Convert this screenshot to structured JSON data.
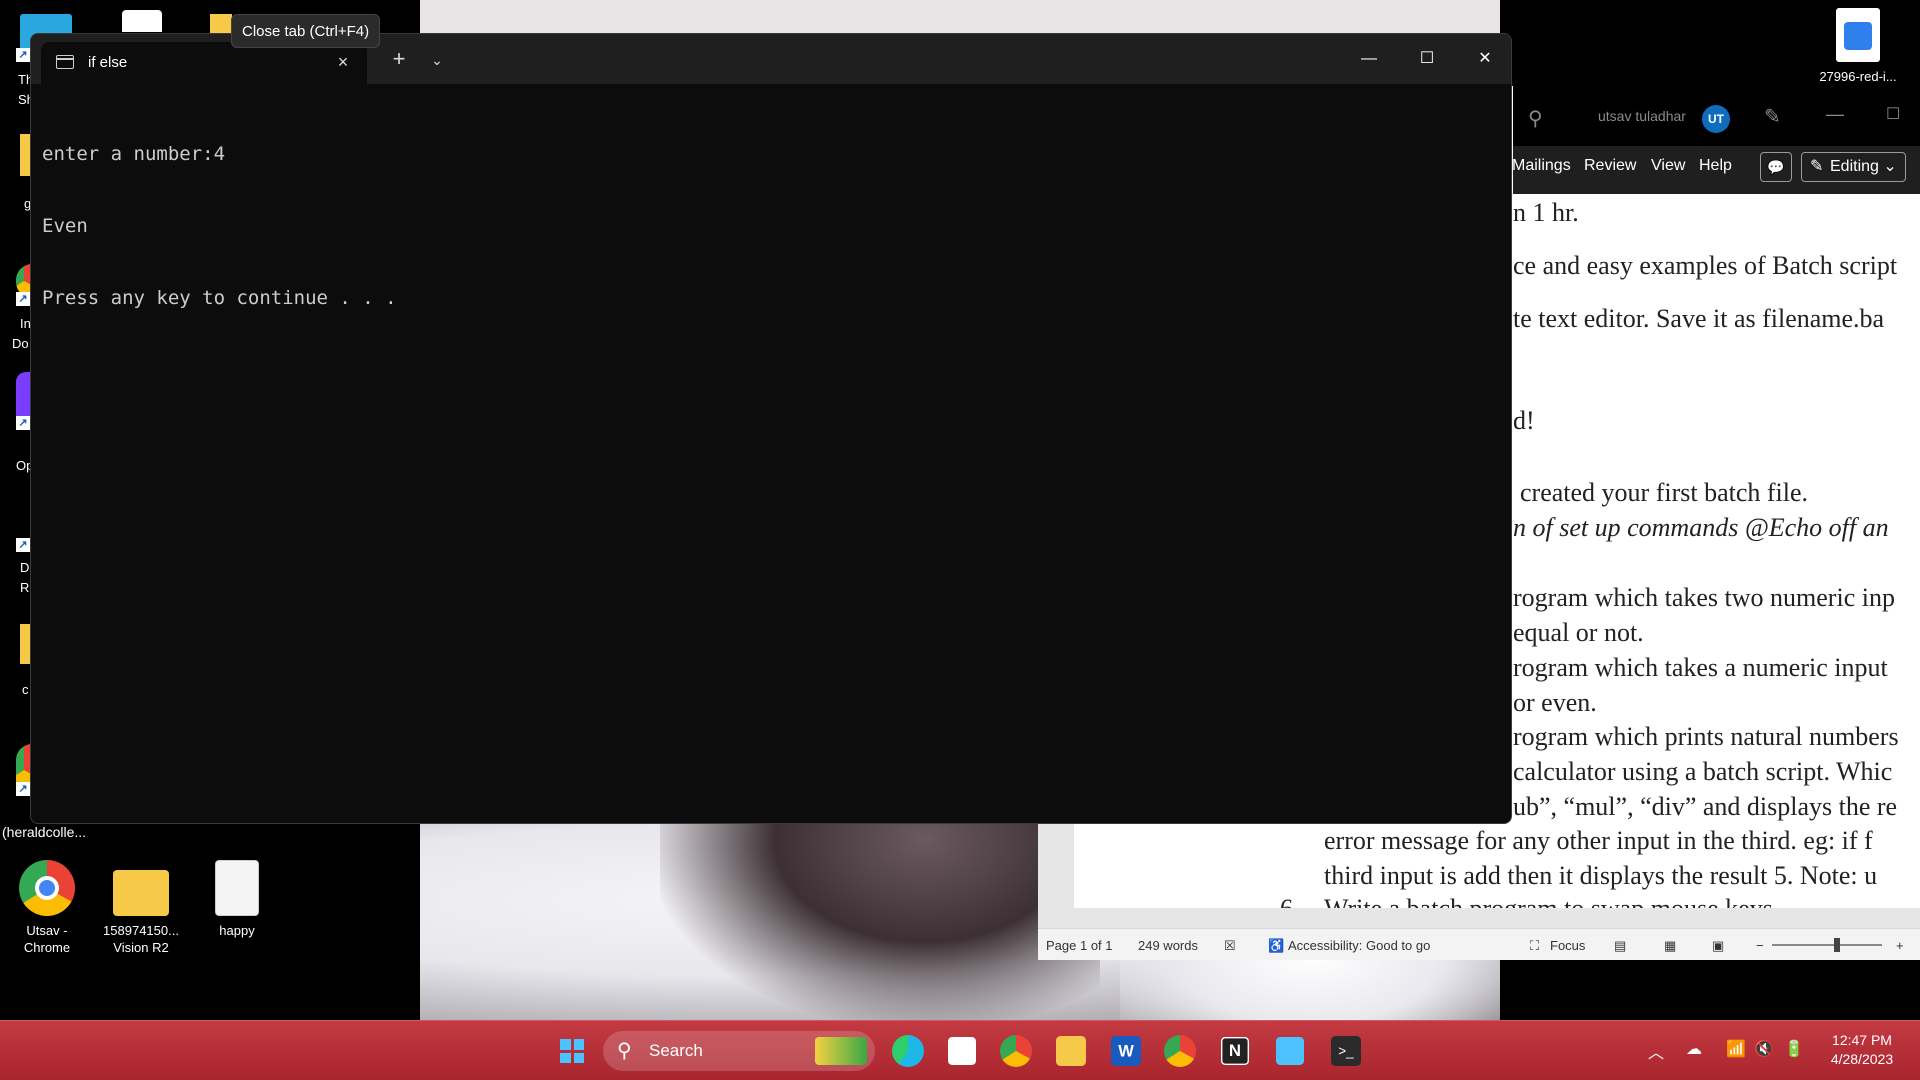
{
  "tooltip": "Close tab (Ctrl+F4)",
  "terminal": {
    "tab_title": "if else",
    "new_tab": "+",
    "dropdown": "⌄",
    "close_tab": "×",
    "minimize": "—",
    "maximize": "☐",
    "close": "✕",
    "lines": [
      "enter a number:4",
      "Even",
      "Press any key to continue . . ."
    ]
  },
  "desktop": {
    "left_labels": [
      "Th",
      "Sh",
      "g",
      "In",
      "Do",
      "Op",
      "D",
      "R",
      "c",
      "(heraldcolle..."
    ],
    "icons": [
      {
        "label": "Utsav -\nChrome",
        "icon": "chrome-icon"
      },
      {
        "label": "158974150...\nVision R2",
        "icon": "folder-icon"
      },
      {
        "label": "happy",
        "icon": "document-icon"
      }
    ],
    "top_right_icon_label": "27996-red-i..."
  },
  "word": {
    "user_name": "utsav tuladhar",
    "avatar_initials": "UT",
    "ribbon_tabs": [
      "Mailings",
      "Review",
      "View",
      "Help"
    ],
    "editing_label": "Editing ⌄",
    "doc_lines": [
      "n 1 hr.",
      "ce and easy examples of Batch script",
      "te text editor. Save it as filename.ba",
      "d!",
      "created your first batch file.",
      "n of set up commands @Echo off an",
      "rogram which takes two numeric inp",
      " equal or not.",
      "rogram which takes a numeric input",
      "or even.",
      "rogram which prints natural numbers",
      "calculator using a batch script. Whic",
      "ub”, “mul”, “div” and displays the re",
      "error message  for any other input in the third. eg: if f",
      "third input is add then it displays the result 5. Note: u",
      "Write a batch program to swap mouse keys"
    ],
    "list_number_6": "6.",
    "status": {
      "page": "Page 1 of 1",
      "words": "249 words",
      "accessibility": "Accessibility: Good to go",
      "focus": "Focus"
    }
  },
  "taskbar": {
    "search_label": "Search",
    "time": "12:47 PM",
    "date": "4/28/2023"
  }
}
